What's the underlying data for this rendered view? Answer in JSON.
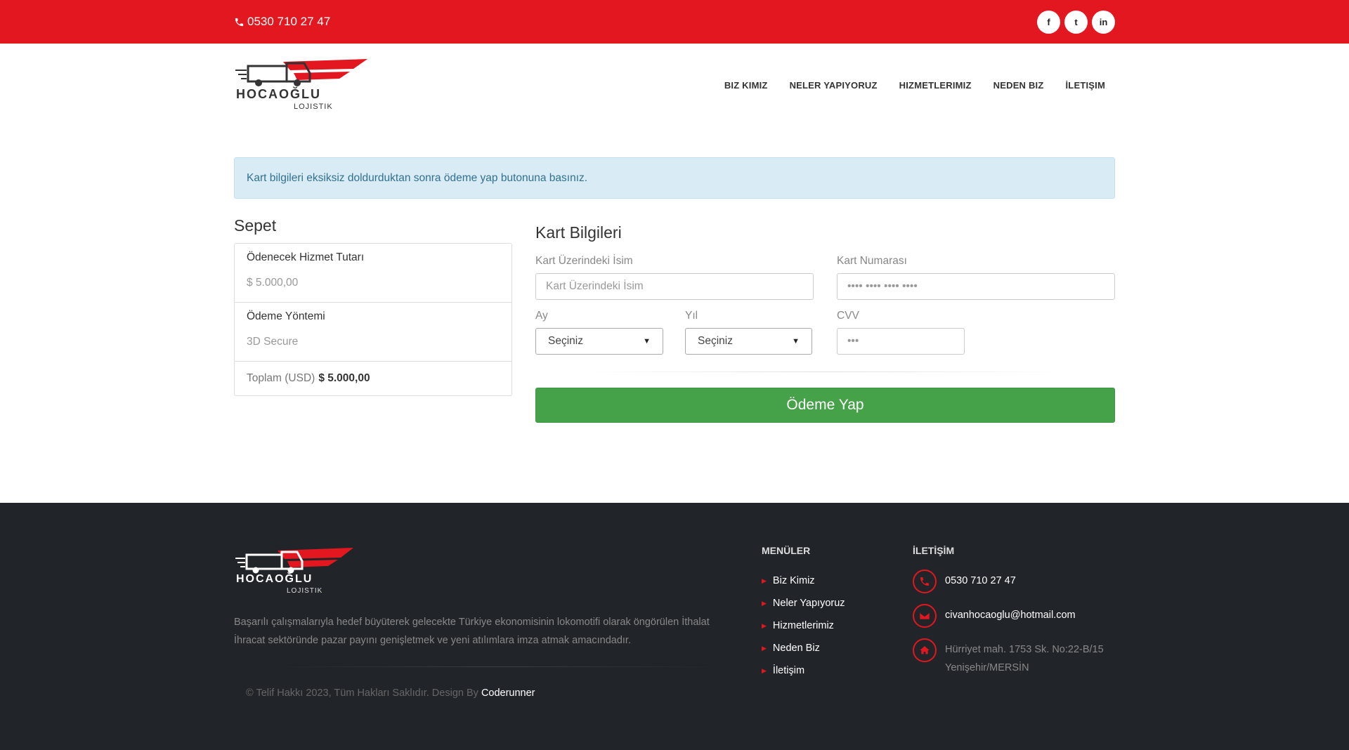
{
  "topbar": {
    "phone": "0530 710 27 47",
    "socials": [
      {
        "icon": "facebook-icon",
        "glyph": "f"
      },
      {
        "icon": "twitter-icon",
        "glyph": "t"
      },
      {
        "icon": "linkedin-icon",
        "glyph": "in"
      }
    ]
  },
  "brand": {
    "name": "HOCAOĞLU",
    "sub": "LOJISTIK"
  },
  "nav": [
    "BIZ KIMIZ",
    "NELER YAPIYORUZ",
    "HIZMETLERIMIZ",
    "NEDEN BIZ",
    "İLETIŞIM"
  ],
  "alert": "Kart bilgileri eksiksiz doldurduktan sonra ödeme yap butonuna basınız.",
  "cart": {
    "title": "Sepet",
    "items": [
      {
        "label": "Ödenecek Hizmet Tutarı",
        "value": "$ 5.000,00"
      },
      {
        "label": "Ödeme Yöntemi",
        "value": "3D Secure"
      }
    ],
    "total_label": "Toplam (USD)",
    "total_value": "$ 5.000,00"
  },
  "form": {
    "title": "Kart Bilgileri",
    "name_label": "Kart Üzerindeki İsim",
    "name_placeholder": "Kart Üzerindeki İsim",
    "number_label": "Kart Numarası",
    "number_placeholder": "•••• •••• •••• ••••",
    "month_label": "Ay",
    "month_value": "Seçiniz",
    "year_label": "Yıl",
    "year_value": "Seçiniz",
    "cvv_label": "CVV",
    "cvv_placeholder": "•••",
    "submit": "Ödeme Yap"
  },
  "footer": {
    "brand": "HOCAOĞLU",
    "sub": "LOJISTIK",
    "description": "Başarılı çalışmalarıyla hedef büyüterek gelecekte Türkiye ekonomisinin lokomotifi olarak öngörülen İthalat İhracat sektöründe pazar payını genişletmek ve yeni atılımlara imza atmak amacındadır.",
    "copyright": "© Telif Hakkı 2023, Tüm Hakları Saklıdır. Design By",
    "designer": "Coderunner",
    "menu_title": "MENÜLER",
    "menu": [
      "Biz Kimiz",
      "Neler Yapıyoruz",
      "Hizmetlerimiz",
      "Neden Biz",
      "İletişim"
    ],
    "contact_title": "İLETİŞİM",
    "phone": "0530 710 27 47",
    "email": "civanhocaoglu@hotmail.com",
    "address": "Hürriyet mah. 1753 Sk. No:22-B/15 Yenişehir/MERSİN"
  },
  "colors": {
    "accent": "#e3171f",
    "button": "#45a248",
    "footer": "#212529",
    "alert_bg": "#d9ecf5",
    "alert_text": "#31708f"
  }
}
